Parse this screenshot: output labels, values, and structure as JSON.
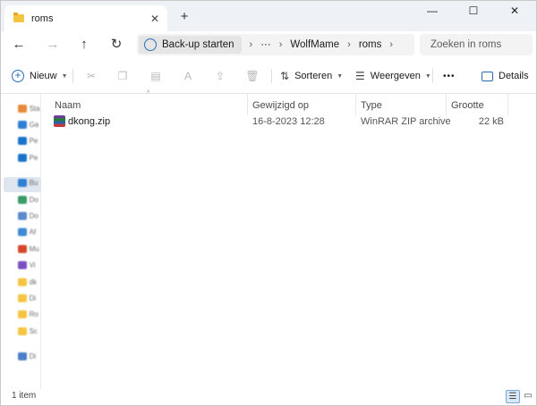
{
  "window": {
    "tab_title": "roms",
    "new_tab": "+",
    "minimize": "—",
    "maximize": "☐",
    "close": "✕"
  },
  "nav": {
    "back": "←",
    "forward": "→",
    "up": "↑",
    "refresh": "↻",
    "address_home": "Back-up starten",
    "address_ellipsis": "···",
    "address_crumbs": [
      "WolfMame",
      "roms"
    ],
    "chevron": "›",
    "search_placeholder": "Zoeken in roms"
  },
  "toolbar": {
    "new_label": "Nieuw",
    "sort_label": "Sorteren",
    "view_label": "Weergeven",
    "more": "•••",
    "details_label": "Details"
  },
  "sidebar": {
    "items": [
      {
        "label": "Sta",
        "color": "#e58a3a"
      },
      {
        "label": "Ga",
        "color": "#2f7fd4"
      },
      {
        "label": "Pe",
        "color": "#1a73c9"
      },
      {
        "label": "Pe",
        "color": "#1a73c9"
      },
      {
        "label": "Bu",
        "color": "#2f7fd4"
      },
      {
        "label": "Do",
        "color": "#3a9a6a"
      },
      {
        "label": "Do",
        "color": "#5a8acc"
      },
      {
        "label": "Af",
        "color": "#3f8ad6"
      },
      {
        "label": "Mu",
        "color": "#d4472b"
      },
      {
        "label": "Vi",
        "color": "#7b4fc2"
      },
      {
        "label": "dk",
        "color": "#f5c542"
      },
      {
        "label": "Di",
        "color": "#f5c542"
      },
      {
        "label": "Ro",
        "color": "#f5c542"
      },
      {
        "label": "Sc",
        "color": "#f5c542"
      },
      {
        "label": "Di",
        "color": "#4a7ec6"
      }
    ]
  },
  "file_list": {
    "columns": [
      "Naam",
      "Gewijzigd op",
      "Type",
      "Grootte"
    ],
    "rows": [
      {
        "name": "dkong.zip",
        "modified": "16-8-2023 12:28",
        "type": "WinRAR ZIP archive",
        "size": "22 kB"
      }
    ]
  },
  "status": {
    "item_count": "1 item"
  }
}
